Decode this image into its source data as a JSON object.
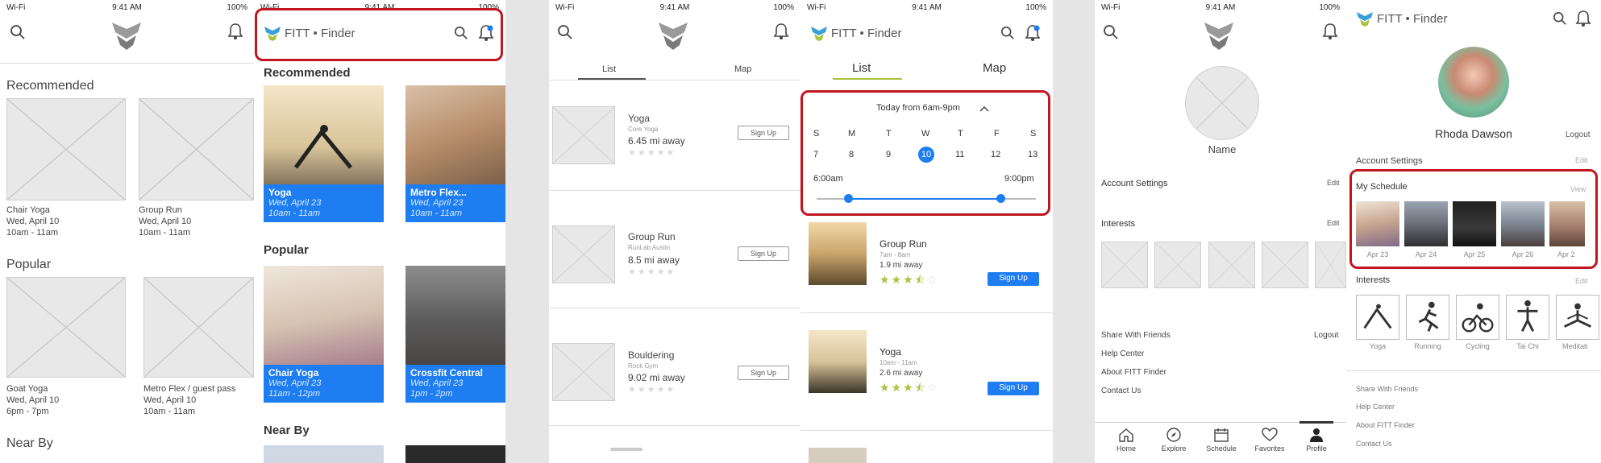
{
  "status": {
    "wifi": "Wi-Fi",
    "time": "9:41 AM",
    "battery": "100%"
  },
  "brand": {
    "logo_text": "FITT • Finder"
  },
  "screen1": {
    "recommended_title": "Recommended",
    "popular_title": "Popular",
    "nearby_title": "Near By",
    "recommended": [
      {
        "name": "Chair Yoga",
        "date": "Wed, April 10",
        "time": "10am - 11am"
      },
      {
        "name": "Group Run",
        "date": "Wed, April 10",
        "time": "10am - 11am"
      }
    ],
    "popular": [
      {
        "name": "Goat Yoga",
        "date": "Wed, April 10",
        "time": "6pm - 7pm"
      },
      {
        "name": "Metro Flex / guest pass",
        "date": "Wed, April 10",
        "time": "10am - 11am"
      }
    ]
  },
  "screen2": {
    "recommended_title": "Recommended",
    "popular_title": "Popular",
    "nearby_title": "Near By",
    "recommended": [
      {
        "name": "Yoga",
        "date": "Wed, April 23",
        "time": "10am - 11am"
      },
      {
        "name": "Metro Flex...",
        "date": "Wed, April 23",
        "time": "10am - 11am"
      }
    ],
    "popular": [
      {
        "name": "Chair Yoga",
        "date": "Wed, April 23",
        "time": "11am - 12pm"
      },
      {
        "name": "Crossfit Central",
        "date": "Wed, April 23",
        "time": "1pm - 2pm"
      }
    ]
  },
  "screen3": {
    "tabs": [
      "List",
      "Map"
    ],
    "items": [
      {
        "name": "Yoga",
        "venue": "Core Yoga",
        "distance": "6.45 mi away",
        "button": "Sign Up"
      },
      {
        "name": "Group Run",
        "venue": "RunLab Austin",
        "distance": "8.5 mi away",
        "button": "Sign Up"
      },
      {
        "name": "Bouldering",
        "venue": "Rock Gym",
        "distance": "9.02 mi away",
        "button": "Sign Up"
      }
    ]
  },
  "screen4": {
    "tabs": [
      "List",
      "Map"
    ],
    "filter": {
      "title": "Today from 6am-9pm",
      "days": [
        "S",
        "M",
        "T",
        "W",
        "T",
        "F",
        "S"
      ],
      "dates": [
        "7",
        "8",
        "9",
        "10",
        "11",
        "12",
        "13"
      ],
      "selected_date": "10",
      "start_time": "6:00am",
      "end_time": "9:00pm"
    },
    "items": [
      {
        "name": "Group Run",
        "time": "7am - 8am",
        "distance": "1.9 mi away",
        "rating": 3.5,
        "button": "Sign Up"
      },
      {
        "name": "Yoga",
        "time": "10am - 11am",
        "distance": "2.6 mi away",
        "rating": 3.5,
        "button": "Sign Up"
      }
    ]
  },
  "screen5": {
    "name": "Name",
    "account_settings": "Account Settings",
    "interests": "Interests",
    "edit": "Edit",
    "links": [
      "Share With Friends",
      "Help Center",
      "About FITT Finder",
      "Contact Us"
    ],
    "logout": "Logout",
    "tabbar": [
      "Home",
      "Explore",
      "Schedule",
      "Favorites",
      "Profile"
    ]
  },
  "screen6": {
    "name": "Rhoda Dawson",
    "logout": "Logout",
    "account_settings": "Account Settings",
    "edit": "Edit",
    "my_schedule": "My Schedule",
    "view": "View",
    "schedule_dates": [
      "Apr 23",
      "Apr 24",
      "Apr 25",
      "Apr 26",
      "Apr 2"
    ],
    "interests": "Interests",
    "interest_items": [
      "Yoga",
      "Running",
      "Cycling",
      "Tai Chi",
      "Meditati"
    ],
    "links": [
      "Share With Friends",
      "Help Center",
      "About FITT Finder",
      "Contact Us"
    ]
  }
}
